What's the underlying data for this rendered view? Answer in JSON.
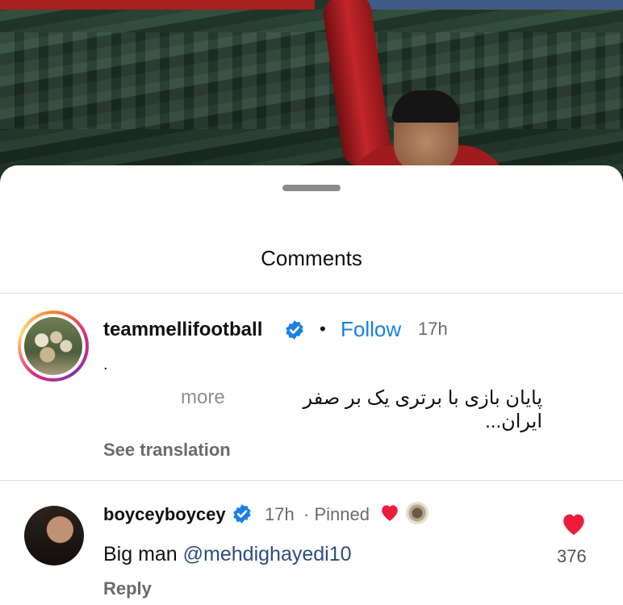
{
  "sheet": {
    "title": "Comments"
  },
  "comments": [
    {
      "username": "teammellifootball",
      "separator": "•",
      "follow_label": "Follow",
      "time": "17h",
      "first_line": ".",
      "text": "پایان بازی با برتری یک بر صفر ایران...",
      "more_label": "more",
      "translation_label": "See translation"
    },
    {
      "username": "boyceyboycey",
      "time": "17h",
      "pinned_label": "· Pinned",
      "text_prefix": "Big man ",
      "mention": "@mehdighayedi10",
      "reply_label": "Reply",
      "like_count": "376"
    }
  ],
  "colors": {
    "accent": "#1a7fe8",
    "heart": "#ed1c3a",
    "verified": "#1a7fe8"
  }
}
